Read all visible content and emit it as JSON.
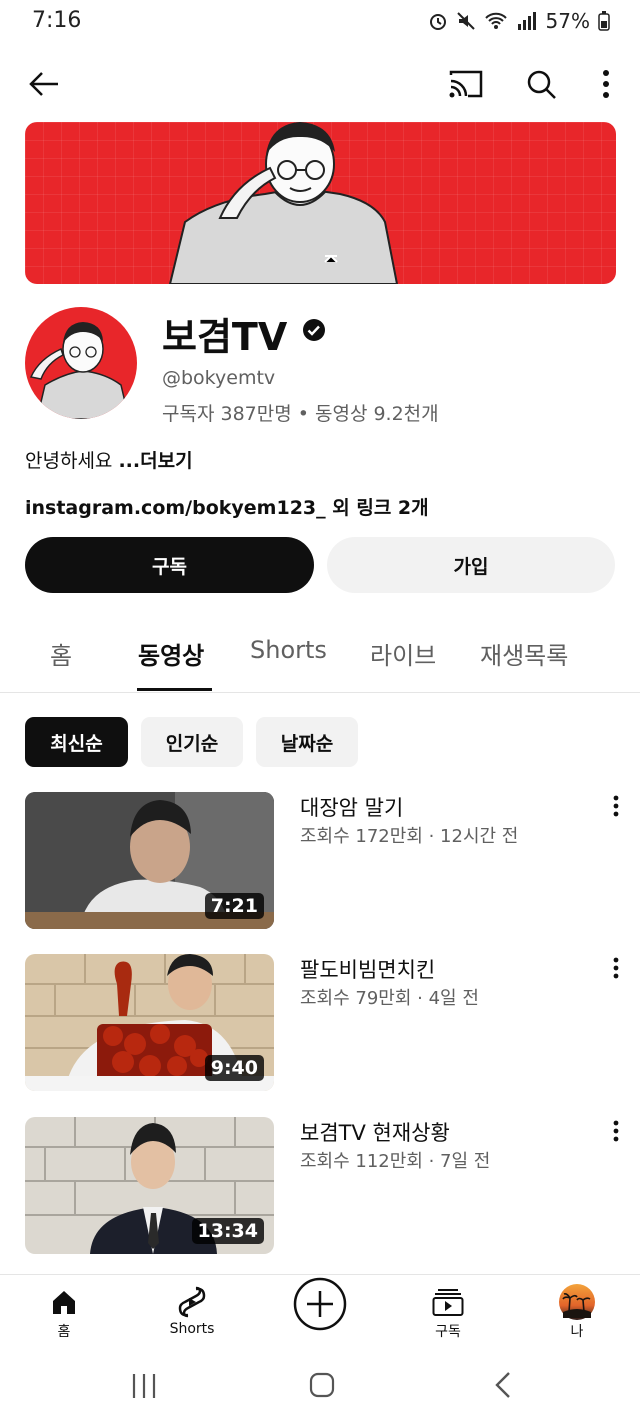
{
  "status_bar": {
    "time": "7:16",
    "battery": "57%"
  },
  "channel": {
    "name": "보겸TV",
    "handle": "@bokyemtv",
    "stats": "구독자 387만명 • 동영상 9.2천개",
    "description": "안녕하세요 ",
    "more_label": "...더보기",
    "link_url": "instagram.com/bokyem123_",
    "link_suffix": " 외 링크 2개"
  },
  "actions": {
    "subscribe_label": "구독",
    "join_label": "가입"
  },
  "tabs": [
    {
      "label": "홈"
    },
    {
      "label": "동영상"
    },
    {
      "label": "Shorts"
    },
    {
      "label": "라이브"
    },
    {
      "label": "재생목록"
    }
  ],
  "active_tab": "동영상",
  "filters": [
    {
      "label": "최신순"
    },
    {
      "label": "인기순"
    },
    {
      "label": "날짜순"
    }
  ],
  "videos": [
    {
      "title": "대장암 말기",
      "meta": "조회수 172만회 · 12시간 전",
      "duration": "7:21"
    },
    {
      "title": "팔도비빔면치킨",
      "meta": "조회수 79만회 · 4일 전",
      "duration": "9:40"
    },
    {
      "title": "보겸TV 현재상황",
      "meta": "조회수 112만회 · 7일 전",
      "duration": "13:34"
    }
  ],
  "bottom_nav": [
    {
      "label": "홈",
      "icon": "home-icon"
    },
    {
      "label": "Shorts",
      "icon": "shorts-icon"
    },
    {
      "label": "",
      "icon": "create-plus-icon"
    },
    {
      "label": "구독",
      "icon": "subscriptions-icon"
    },
    {
      "label": "나",
      "icon": "profile-avatar"
    }
  ],
  "colors": {
    "brand_red": "#e8262a",
    "text": "#0f0f0f",
    "secondary": "#606060"
  }
}
